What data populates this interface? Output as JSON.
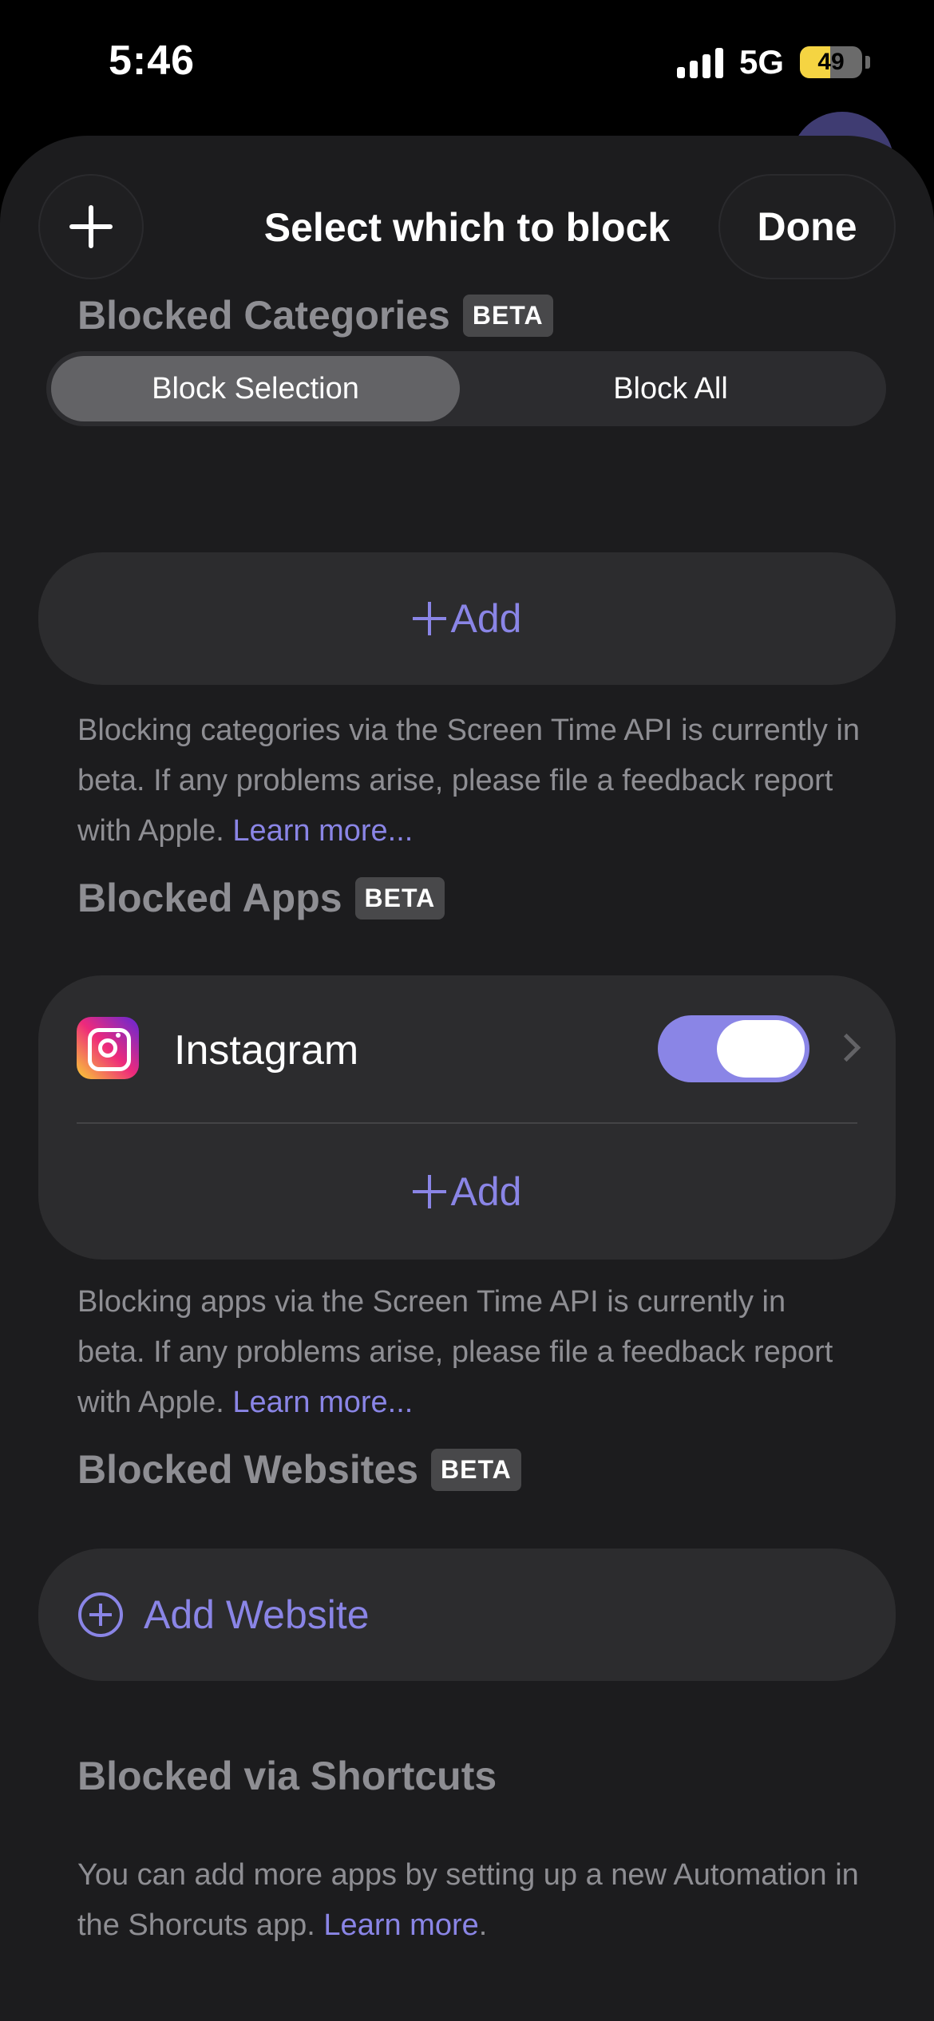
{
  "status_bar": {
    "time": "5:46",
    "network": "5G",
    "battery": "49",
    "battery_percent": 49
  },
  "sheet": {
    "title": "Select which to block",
    "done_label": "Done",
    "add_icon": "plus-icon"
  },
  "segmented": {
    "options": [
      "Block Selection",
      "Block All"
    ],
    "selected": "Block Selection"
  },
  "categories": {
    "title": "Blocked Categories",
    "badge": "BETA",
    "add_label": "Add",
    "footer_text": "Blocking categories via the Screen Time API is currently in beta. If any problems arise, please file a feedback report with Apple. ",
    "footer_link": "Learn more..."
  },
  "apps": {
    "title": "Blocked Apps",
    "badge": "BETA",
    "items": [
      {
        "name": "Instagram",
        "icon": "instagram-icon",
        "enabled": true
      }
    ],
    "add_label": "Add",
    "footer_text": "Blocking apps via the Screen Time API is currently in beta. If any problems arise, please file a feedback report with Apple. ",
    "footer_link": "Learn more..."
  },
  "websites": {
    "title": "Blocked Websites",
    "badge": "BETA",
    "add_label": "Add Website"
  },
  "shortcuts": {
    "title": "Blocked via Shortcuts",
    "footer_text": "You can add more apps by setting up a new Automation in the Shorcuts app. ",
    "footer_link": "Learn more",
    "footer_end": "."
  },
  "colors": {
    "accent": "#8a85e6",
    "sheet_background": "#1c1c1e",
    "card_background": "#2c2c2e",
    "battery_fill": "#f5d442"
  }
}
